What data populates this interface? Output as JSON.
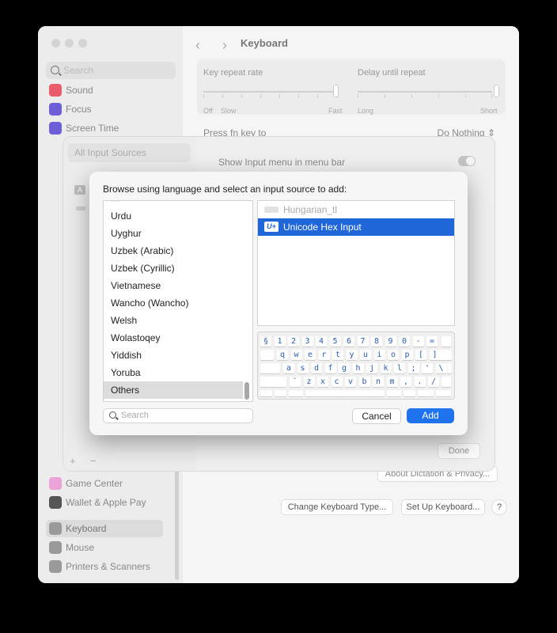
{
  "window": {
    "title": "Keyboard",
    "search_placeholder": "Search"
  },
  "sidebar": {
    "items": [
      {
        "label": "Sound",
        "color": "#e85c6b"
      },
      {
        "label": "Focus",
        "color": "#6c5fd8"
      },
      {
        "label": "Screen Time",
        "color": "#6c5fd8"
      },
      {
        "label": "Game Center",
        "color": "#e9a3d6"
      },
      {
        "label": "Wallet & Apple Pay",
        "color": "#555555"
      },
      {
        "label": "Keyboard",
        "color": "#9a9a9a"
      },
      {
        "label": "Mouse",
        "color": "#9a9a9a"
      },
      {
        "label": "Printers & Scanners",
        "color": "#9a9a9a"
      }
    ]
  },
  "keyboard_settings": {
    "key_repeat_label": "Key repeat rate",
    "delay_label": "Delay until repeat",
    "repeat_min": "Off",
    "repeat_slow": "Slow",
    "repeat_fast": "Fast",
    "delay_long": "Long",
    "delay_short": "Short",
    "fn_label": "Press fn key to",
    "fn_value": "Do Nothing",
    "dictation_privacy": "About Dictation & Privacy...",
    "change_keyboard_type": "Change Keyboard Type...",
    "setup_keyboard": "Set Up Keyboard...",
    "help": "?"
  },
  "input_sources_sheet": {
    "all_sources": "All Input Sources",
    "show_menu": "Show Input menu in menu bar",
    "plus": "+",
    "minus": "−",
    "done": "Done"
  },
  "dialog": {
    "prompt": "Browse using language and select an input source to add:",
    "languages": [
      "Urdu",
      "Uyghur",
      "Uzbek (Arabic)",
      "Uzbek (Cyrillic)",
      "Vietnamese",
      "Wancho (Wancho)",
      "Welsh",
      "Wolastoqey",
      "Yiddish",
      "Yoruba",
      "Others"
    ],
    "selected_language": "Others",
    "sources": [
      {
        "label": "Hungarian_tl",
        "icon": "keyboard-icon",
        "state": "disabled"
      },
      {
        "label": "Unicode Hex Input",
        "icon": "U+",
        "state": "selected"
      }
    ],
    "keyboard_rows": [
      [
        "§",
        "1",
        "2",
        "3",
        "4",
        "5",
        "6",
        "7",
        "8",
        "9",
        "0",
        "-",
        "="
      ],
      [
        "q",
        "w",
        "e",
        "r",
        "t",
        "y",
        "u",
        "i",
        "o",
        "p",
        "[",
        "]"
      ],
      [
        "a",
        "s",
        "d",
        "f",
        "g",
        "h",
        "j",
        "k",
        "l",
        ";",
        "'",
        "\\"
      ],
      [
        "`",
        "z",
        "x",
        "c",
        "v",
        "b",
        "n",
        "m",
        ",",
        ".",
        "/"
      ]
    ],
    "search_placeholder": "Search",
    "cancel": "Cancel",
    "add": "Add",
    "accent": "#1f74ee"
  }
}
